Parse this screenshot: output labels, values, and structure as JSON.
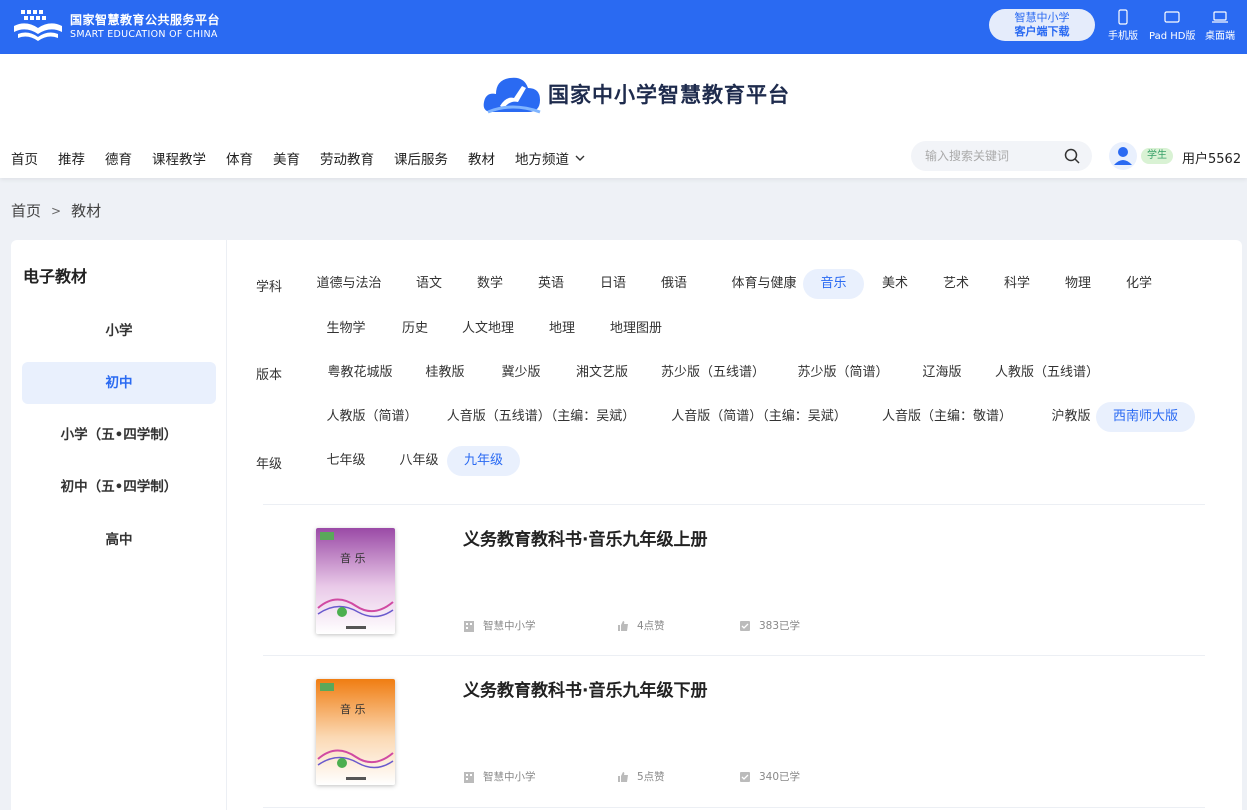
{
  "topbar": {
    "brand_cn": "国家智慧教育公共服务平台",
    "brand_en": "SMART EDUCATION OF CHINA",
    "download_line1": "智慧中小学",
    "download_line2": "客户端下载",
    "devices": [
      "手机版",
      "Pad HD版",
      "桌面端"
    ]
  },
  "header": {
    "title": "国家中小学智慧教育平台",
    "nav": [
      "首页",
      "推荐",
      "德育",
      "课程教学",
      "体育",
      "美育",
      "劳动教育",
      "课后服务",
      "教材",
      "地方频道"
    ],
    "search_placeholder": "输入搜索关键词",
    "role_badge": "学生",
    "username": "用户5562"
  },
  "breadcrumb": [
    "首页",
    "教材"
  ],
  "sidebar": {
    "title": "电子教材",
    "items": [
      "小学",
      "初中",
      "小学（五•四学制）",
      "初中（五•四学制）",
      "高中"
    ],
    "active_index": 1
  },
  "filters": {
    "subject_label": "学科",
    "subjects": [
      "道德与法治",
      "语文",
      "数学",
      "英语",
      "日语",
      "俄语",
      "体育与健康",
      "音乐",
      "美术",
      "艺术",
      "科学",
      "物理",
      "化学",
      "生物学",
      "历史",
      "人文地理",
      "地理",
      "地理图册"
    ],
    "subject_active": "音乐",
    "edition_label": "版本",
    "editions": [
      "粤教花城版",
      "桂教版",
      "冀少版",
      "湘文艺版",
      "苏少版（五线谱）",
      "苏少版（简谱）",
      "辽海版",
      "人教版（五线谱）",
      "人教版（简谱）",
      "人音版（五线谱）（主编：吴斌）",
      "人音版（简谱）（主编：吴斌）",
      "人音版（主编：敬谱）",
      "沪教版",
      "西南师大版"
    ],
    "edition_active": "西南师大版",
    "grade_label": "年级",
    "grades": [
      "七年级",
      "八年级",
      "九年级"
    ],
    "grade_active": "九年级"
  },
  "books": [
    {
      "title": "义务教育教科书·音乐九年级上册",
      "publisher": "智慧中小学",
      "likes": "4点赞",
      "learned": "383已学",
      "cover_color": "#b86bb6",
      "cover_text": "音 乐"
    },
    {
      "title": "义务教育教科书·音乐九年级下册",
      "publisher": "智慧中小学",
      "likes": "5点赞",
      "learned": "340已学",
      "cover_color": "#f28a1e",
      "cover_text": "音 乐"
    }
  ]
}
